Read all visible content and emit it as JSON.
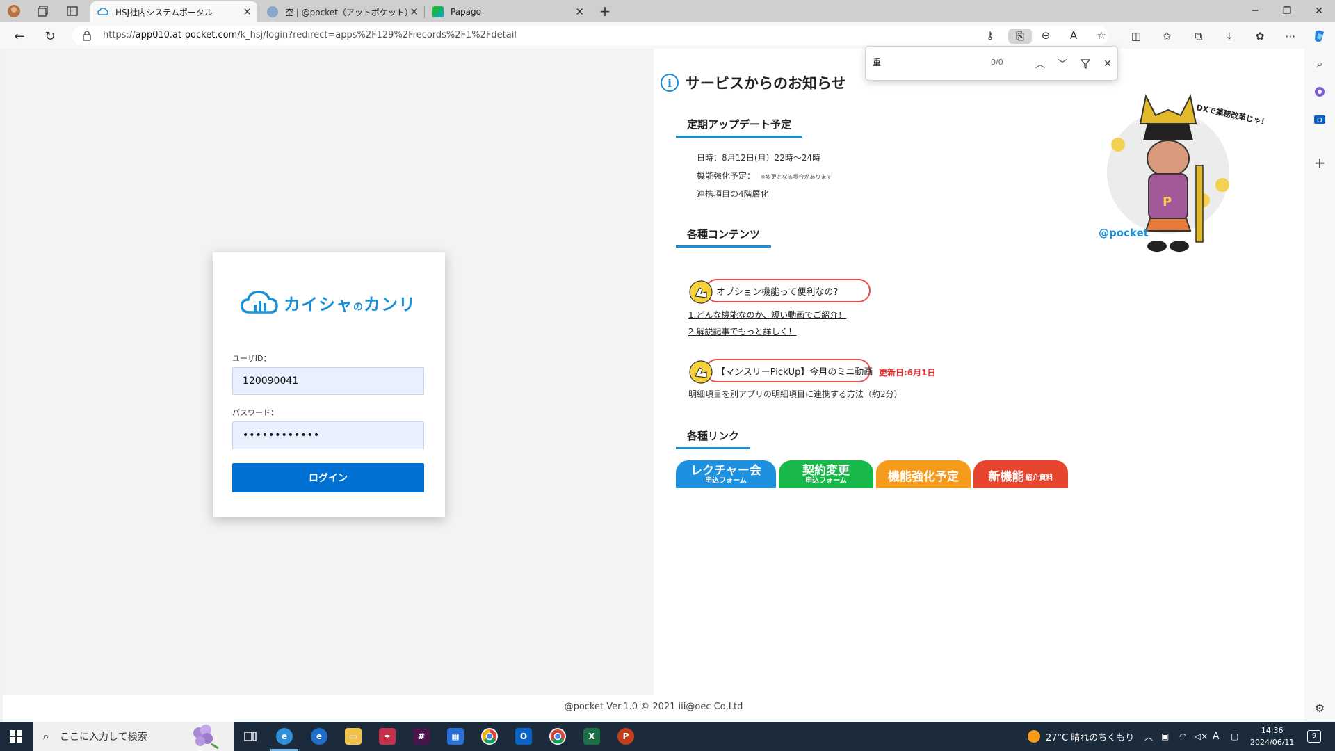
{
  "browser": {
    "tabs": [
      {
        "title": "HSJ社内システムポータル",
        "active": true
      },
      {
        "title": "空 | @pocket（アットポケット）サポ",
        "active": false
      },
      {
        "title": "Papago",
        "active": false
      }
    ],
    "url_prefix": "https://",
    "url_host": "app010.at-pocket.com",
    "url_path": "/k_hsj/login?redirect=apps%2F129%2Frecords%2F1%2Fdetail"
  },
  "find_bar": {
    "query": "重",
    "count": "0/0"
  },
  "login": {
    "logo_text": "カイシャ",
    "logo_small": "の",
    "logo_text2": "カンリ",
    "user_label": "ユーザID：",
    "user_value": "120090041",
    "password_label": "パスワード：",
    "password_value": "••••••••••••",
    "login_button": "ログイン"
  },
  "notice": {
    "title": "サービスからのお知らせ",
    "info_glyph": "i",
    "update_section": {
      "heading": "定期アップデート予定",
      "date_line": "日時：8月12日(月）22時～24時",
      "feature_label": "機能強化予定：",
      "feature_note": "※変更となる場合があります",
      "feature_item": "連携項目の4階層化"
    },
    "contents_section": {
      "heading": "各種コンテンツ",
      "option_pill": "オプション機能って便利なの？",
      "link1": "1.どんな機能なのか、短い動画でご紹介！",
      "link2": "2.解説記事でもっと詳しく！",
      "monthly_pill": "【マンスリーPickUp】今月のミニ動画",
      "updated_label": "更新日:6月1日",
      "monthly_desc": "明細項目を別アプリの明細項目に連携する方法（約2分）"
    },
    "links_section": {
      "heading": "各種リンク",
      "buttons": [
        {
          "main": "レクチャー会",
          "sub": "申込フォーム",
          "color": "#1e90e0"
        },
        {
          "main": "契約変更",
          "sub": "申込フォーム",
          "color": "#19b84a"
        },
        {
          "main": "機能強化予定",
          "sub": "",
          "color": "#f59a1a"
        },
        {
          "main": "新機能",
          "sub": "紹介資料",
          "color": "#e8452f"
        }
      ]
    },
    "mascot_caption": "DXで業務改革じゃ！",
    "mascot_brand": "@pocket"
  },
  "footer": {
    "text": "@pocket Ver.1.0 © 2021 iii@oec Co,Ltd"
  },
  "taskbar": {
    "search_placeholder": "ここに入力して検索",
    "weather": "27°C  晴れのちくもり",
    "time": "14:36",
    "date": "2024/06/11",
    "ime": "A",
    "notification_count": "9"
  }
}
